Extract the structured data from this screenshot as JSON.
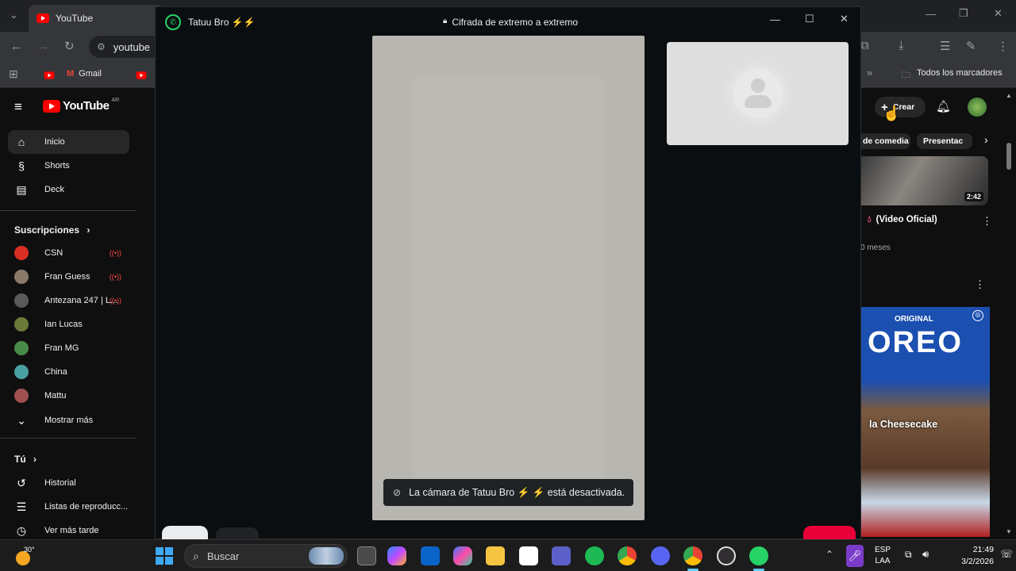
{
  "chrome": {
    "tab_title": "YouTube",
    "address_text": "youtube",
    "bookmarks": {
      "gmail": "Gmail",
      "all_bookmarks": "Todos los marcadores"
    }
  },
  "youtube": {
    "logo_text": "YouTube",
    "logo_region": "AR",
    "create_label": "Crear",
    "nav": [
      {
        "label": "Inicio",
        "icon": "home-icon"
      },
      {
        "label": "Shorts",
        "icon": "shorts-icon"
      },
      {
        "label": "Deck",
        "icon": "deck-icon"
      }
    ],
    "subscriptions_heading": "Suscripciones",
    "subscriptions": [
      {
        "label": "CSN",
        "color": "#d93025",
        "live": true
      },
      {
        "label": "Fran Guess",
        "color": "#8a7a6a",
        "live": true
      },
      {
        "label": "Antezana 247 | L...",
        "color": "#5a5a5a",
        "live": true
      },
      {
        "label": "Ian Lucas",
        "color": "#6b7a3a",
        "live": false
      },
      {
        "label": "Fran MG",
        "color": "#4a8a4a",
        "live": false
      },
      {
        "label": "China",
        "color": "#4aa0a0",
        "live": false
      },
      {
        "label": "Mattu",
        "color": "#a05050",
        "live": false
      }
    ],
    "show_more": "Mostrar más",
    "you_heading": "Tú",
    "you_items": [
      {
        "label": "Historial",
        "icon": "history-icon"
      },
      {
        "label": "Listas de reproducc...",
        "icon": "playlist-icon"
      },
      {
        "label": "Ver más tarde",
        "icon": "watch-later-icon"
      }
    ],
    "chips": [
      "de comedia",
      "Presentac"
    ],
    "video": {
      "duration": "2:42",
      "title": "(Video Oficial)",
      "meta": "0 meses"
    },
    "short_thumb": {
      "brand": "ORIGINAL",
      "brand_big": "OREO",
      "caption": "la Cheesecake"
    }
  },
  "whatsapp": {
    "title": "Tatuu Bro ⚡⚡",
    "encryption": "Cifrada de extremo a extremo",
    "camera_off_toast": "La cámara de Tatuu Bro ⚡ ⚡ está desactivada."
  },
  "taskbar": {
    "weather_temp": "30°",
    "search_placeholder": "Buscar",
    "lang_top": "ESP",
    "lang_bottom": "LAA",
    "time": "21:49",
    "date": "3/2/2026"
  }
}
